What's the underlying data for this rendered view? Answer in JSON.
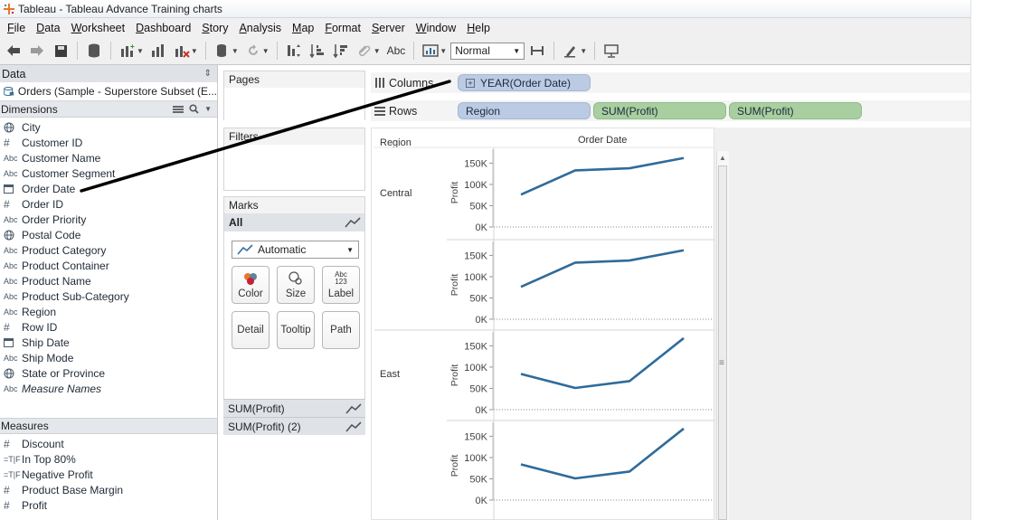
{
  "window": {
    "title": "Tableau - Tableau Advance Training charts"
  },
  "menu": [
    {
      "label": "File",
      "u": "F",
      "rest": "ile"
    },
    {
      "label": "Data",
      "u": "D",
      "rest": "ata"
    },
    {
      "label": "Worksheet",
      "u": "W",
      "rest": "orksheet"
    },
    {
      "label": "Dashboard",
      "u": "D",
      "rest": "ashboard"
    },
    {
      "label": "Story",
      "u": "S",
      "rest": "tory"
    },
    {
      "label": "Analysis",
      "u": "A",
      "rest": "nalysis"
    },
    {
      "label": "Map",
      "u": "M",
      "rest": "ap"
    },
    {
      "label": "Format",
      "u": "F",
      "rest": "ormat"
    },
    {
      "label": "Server",
      "u": "S",
      "rest": "erver"
    },
    {
      "label": "Window",
      "u": "W",
      "rest": "indow"
    },
    {
      "label": "Help",
      "u": "H",
      "rest": "elp"
    }
  ],
  "toolbar": {
    "label_text": "Abc",
    "fit_value": "Normal"
  },
  "data_pane": {
    "title": "Data",
    "datasource": "Orders (Sample - Superstore Subset (E...",
    "dimensions_title": "Dimensions",
    "dimensions": [
      {
        "name": "City",
        "type": "geo"
      },
      {
        "name": "Customer ID",
        "type": "hash"
      },
      {
        "name": "Customer Name",
        "type": "abc"
      },
      {
        "name": "Customer Segment",
        "type": "abc"
      },
      {
        "name": "Order Date",
        "type": "date"
      },
      {
        "name": "Order ID",
        "type": "hash"
      },
      {
        "name": "Order Priority",
        "type": "abc"
      },
      {
        "name": "Postal Code",
        "type": "geo"
      },
      {
        "name": "Product Category",
        "type": "abc"
      },
      {
        "name": "Product Container",
        "type": "abc"
      },
      {
        "name": "Product Name",
        "type": "abc"
      },
      {
        "name": "Product Sub-Category",
        "type": "abc"
      },
      {
        "name": "Region",
        "type": "abc"
      },
      {
        "name": "Row ID",
        "type": "hash"
      },
      {
        "name": "Ship Date",
        "type": "date"
      },
      {
        "name": "Ship Mode",
        "type": "abc"
      },
      {
        "name": "State or Province",
        "type": "geo"
      },
      {
        "name": "Measure Names",
        "type": "abc",
        "italic": true
      }
    ],
    "measures_title": "Measures",
    "measures": [
      {
        "name": "Discount",
        "type": "hash"
      },
      {
        "name": "In Top 80%",
        "type": "tf"
      },
      {
        "name": "Negative Profit",
        "type": "tf"
      },
      {
        "name": "Product Base Margin",
        "type": "hash"
      },
      {
        "name": "Profit",
        "type": "hash"
      }
    ]
  },
  "cards": {
    "pages_title": "Pages",
    "filters_title": "Filters",
    "marks_title": "Marks",
    "marks_all": "All",
    "mark_type": "Automatic",
    "buttons": {
      "color": "Color",
      "size": "Size",
      "label": "Label",
      "detail": "Detail",
      "tooltip": "Tooltip",
      "path": "Path",
      "label_icon_top": "Abc",
      "label_icon_bottom": "123"
    },
    "marks_pills": [
      "SUM(Profit)",
      "SUM(Profit) (2)"
    ]
  },
  "shelves": {
    "columns_label": "Columns",
    "rows_label": "Rows",
    "columns_pills": [
      "YEAR(Order Date)"
    ],
    "rows_pills": [
      {
        "label": "Region",
        "kind": "blue"
      },
      {
        "label": "SUM(Profit)",
        "kind": "green"
      },
      {
        "label": "SUM(Profit)",
        "kind": "green"
      }
    ]
  },
  "viz": {
    "row_header": "Region",
    "column_header": "Order Date",
    "regions": [
      "Central",
      "East"
    ],
    "axis_title": "Profit",
    "ticks": [
      "0K",
      "50K",
      "100K",
      "150K"
    ]
  },
  "chart_data": {
    "type": "line",
    "axis_title": "Profit",
    "ylim": [
      0,
      170000
    ],
    "yticks": [
      0,
      50000,
      100000,
      150000
    ],
    "ytick_labels": [
      "0K",
      "50K",
      "100K",
      "150K"
    ],
    "row_categories": [
      "Central",
      "East"
    ],
    "panes": [
      {
        "region": "Central",
        "measure": "SUM(Profit)",
        "values": [
          76000,
          133000,
          138000,
          162000
        ]
      },
      {
        "region": "Central",
        "measure": "SUM(Profit)",
        "values": [
          76000,
          133000,
          138000,
          162000
        ]
      },
      {
        "region": "East",
        "measure": "SUM(Profit)",
        "values": [
          84000,
          51000,
          67000,
          168000
        ]
      },
      {
        "region": "East",
        "measure": "SUM(Profit)",
        "values": [
          84000,
          51000,
          67000,
          168000
        ]
      }
    ],
    "line_color": "#2f6b9a",
    "grid": false
  },
  "colors": {
    "line": "#2f6b9a",
    "pill_blue": "#bccbe4",
    "pill_green": "#a9cfa0"
  }
}
